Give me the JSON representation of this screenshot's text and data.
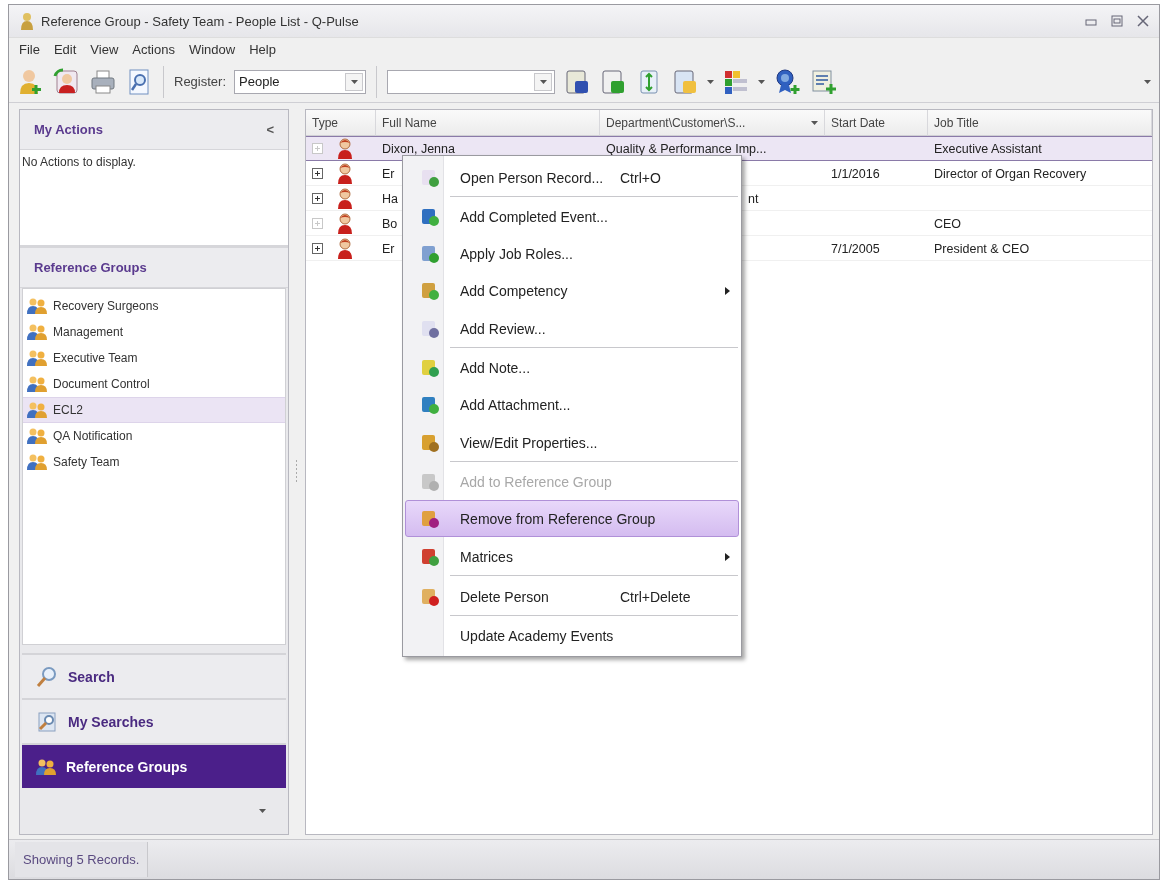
{
  "window": {
    "title": "Reference Group - Safety Team - People List - Q-Pulse"
  },
  "menu_bar": [
    "File",
    "Edit",
    "View",
    "Actions",
    "Window",
    "Help"
  ],
  "toolbar": {
    "register_label": "Register:",
    "register_value": "People"
  },
  "my_actions": {
    "title": "My Actions",
    "collapse": "<",
    "empty_text": "No Actions to display."
  },
  "reference_groups": {
    "title": "Reference Groups",
    "items": [
      {
        "label": "Recovery Surgeons",
        "selected": false
      },
      {
        "label": "Management",
        "selected": false
      },
      {
        "label": "Executive Team",
        "selected": false
      },
      {
        "label": "Document Control",
        "selected": false
      },
      {
        "label": "ECL2",
        "selected": true
      },
      {
        "label": "QA Notification",
        "selected": false
      },
      {
        "label": "Safety Team",
        "selected": false
      }
    ]
  },
  "nav": [
    {
      "label": "Search",
      "kind": "search",
      "selected": false
    },
    {
      "label": "My Searches",
      "kind": "saved",
      "selected": false
    },
    {
      "label": "Reference Groups",
      "kind": "groups",
      "selected": true
    }
  ],
  "table": {
    "columns": [
      {
        "label": "Type",
        "sortable": false
      },
      {
        "label": "Full Name",
        "sortable": false
      },
      {
        "label": "Department\\Customer\\S...",
        "sortable": true
      },
      {
        "label": "Start Date",
        "sortable": false
      },
      {
        "label": "Job Title",
        "sortable": false
      }
    ],
    "rows": [
      {
        "selected": true,
        "has_children": false,
        "name": "Dixon, Jenna",
        "department": "Quality & Performance Imp...",
        "dept_partly_hidden": false,
        "start_date": "",
        "job_title": "Executive Assistant"
      },
      {
        "selected": false,
        "has_children": true,
        "name": "Er",
        "department": "",
        "dept_partly_hidden": false,
        "start_date": "1/1/2016",
        "job_title": "Director of Organ Recovery"
      },
      {
        "selected": false,
        "has_children": true,
        "name": "Ha",
        "department": "nt",
        "dept_partly_hidden": true,
        "start_date": "",
        "job_title": ""
      },
      {
        "selected": false,
        "has_children": false,
        "name": "Bo",
        "department": "",
        "dept_partly_hidden": false,
        "start_date": "",
        "job_title": "CEO"
      },
      {
        "selected": false,
        "has_children": true,
        "name": "Er",
        "department": "",
        "dept_partly_hidden": false,
        "start_date": "7/1/2005",
        "job_title": "President & CEO"
      }
    ]
  },
  "context_menu": [
    {
      "kind": "open",
      "label": "Open Person Record...",
      "shortcut": "Ctrl+O",
      "submenu": false,
      "disabled": false,
      "selected": false,
      "separator_after": true
    },
    {
      "kind": "event",
      "label": "Add Completed Event...",
      "submenu": false,
      "disabled": false,
      "selected": false,
      "separator_after": false
    },
    {
      "kind": "roles",
      "label": "Apply Job Roles...",
      "submenu": false,
      "disabled": false,
      "selected": false,
      "separator_after": false
    },
    {
      "kind": "competency",
      "label": "Add Competency",
      "submenu": true,
      "disabled": false,
      "selected": false,
      "separator_after": false
    },
    {
      "kind": "review",
      "label": "Add Review...",
      "submenu": false,
      "disabled": false,
      "selected": false,
      "separator_after": true
    },
    {
      "kind": "note",
      "label": "Add Note...",
      "submenu": false,
      "disabled": false,
      "selected": false,
      "separator_after": false
    },
    {
      "kind": "attachment",
      "label": "Add Attachment...",
      "submenu": false,
      "disabled": false,
      "selected": false,
      "separator_after": false
    },
    {
      "kind": "properties",
      "label": "View/Edit Properties...",
      "submenu": false,
      "disabled": false,
      "selected": false,
      "separator_after": true
    },
    {
      "kind": "addgroup",
      "label": "Add to Reference Group",
      "submenu": false,
      "disabled": true,
      "selected": false,
      "separator_after": false
    },
    {
      "kind": "removegroup",
      "label": "Remove from Reference Group",
      "submenu": false,
      "disabled": false,
      "selected": true,
      "separator_after": false
    },
    {
      "kind": "matrices",
      "label": "Matrices",
      "submenu": true,
      "disabled": false,
      "selected": false,
      "separator_after": true
    },
    {
      "kind": "delete",
      "label": "Delete Person",
      "shortcut": "Ctrl+Delete",
      "submenu": false,
      "disabled": false,
      "selected": false,
      "separator_after": true
    },
    {
      "kind": "plain",
      "label": "Update Academy Events",
      "submenu": false,
      "disabled": false,
      "selected": false,
      "separator_after": false
    }
  ],
  "status_bar": "Showing 5 Records."
}
